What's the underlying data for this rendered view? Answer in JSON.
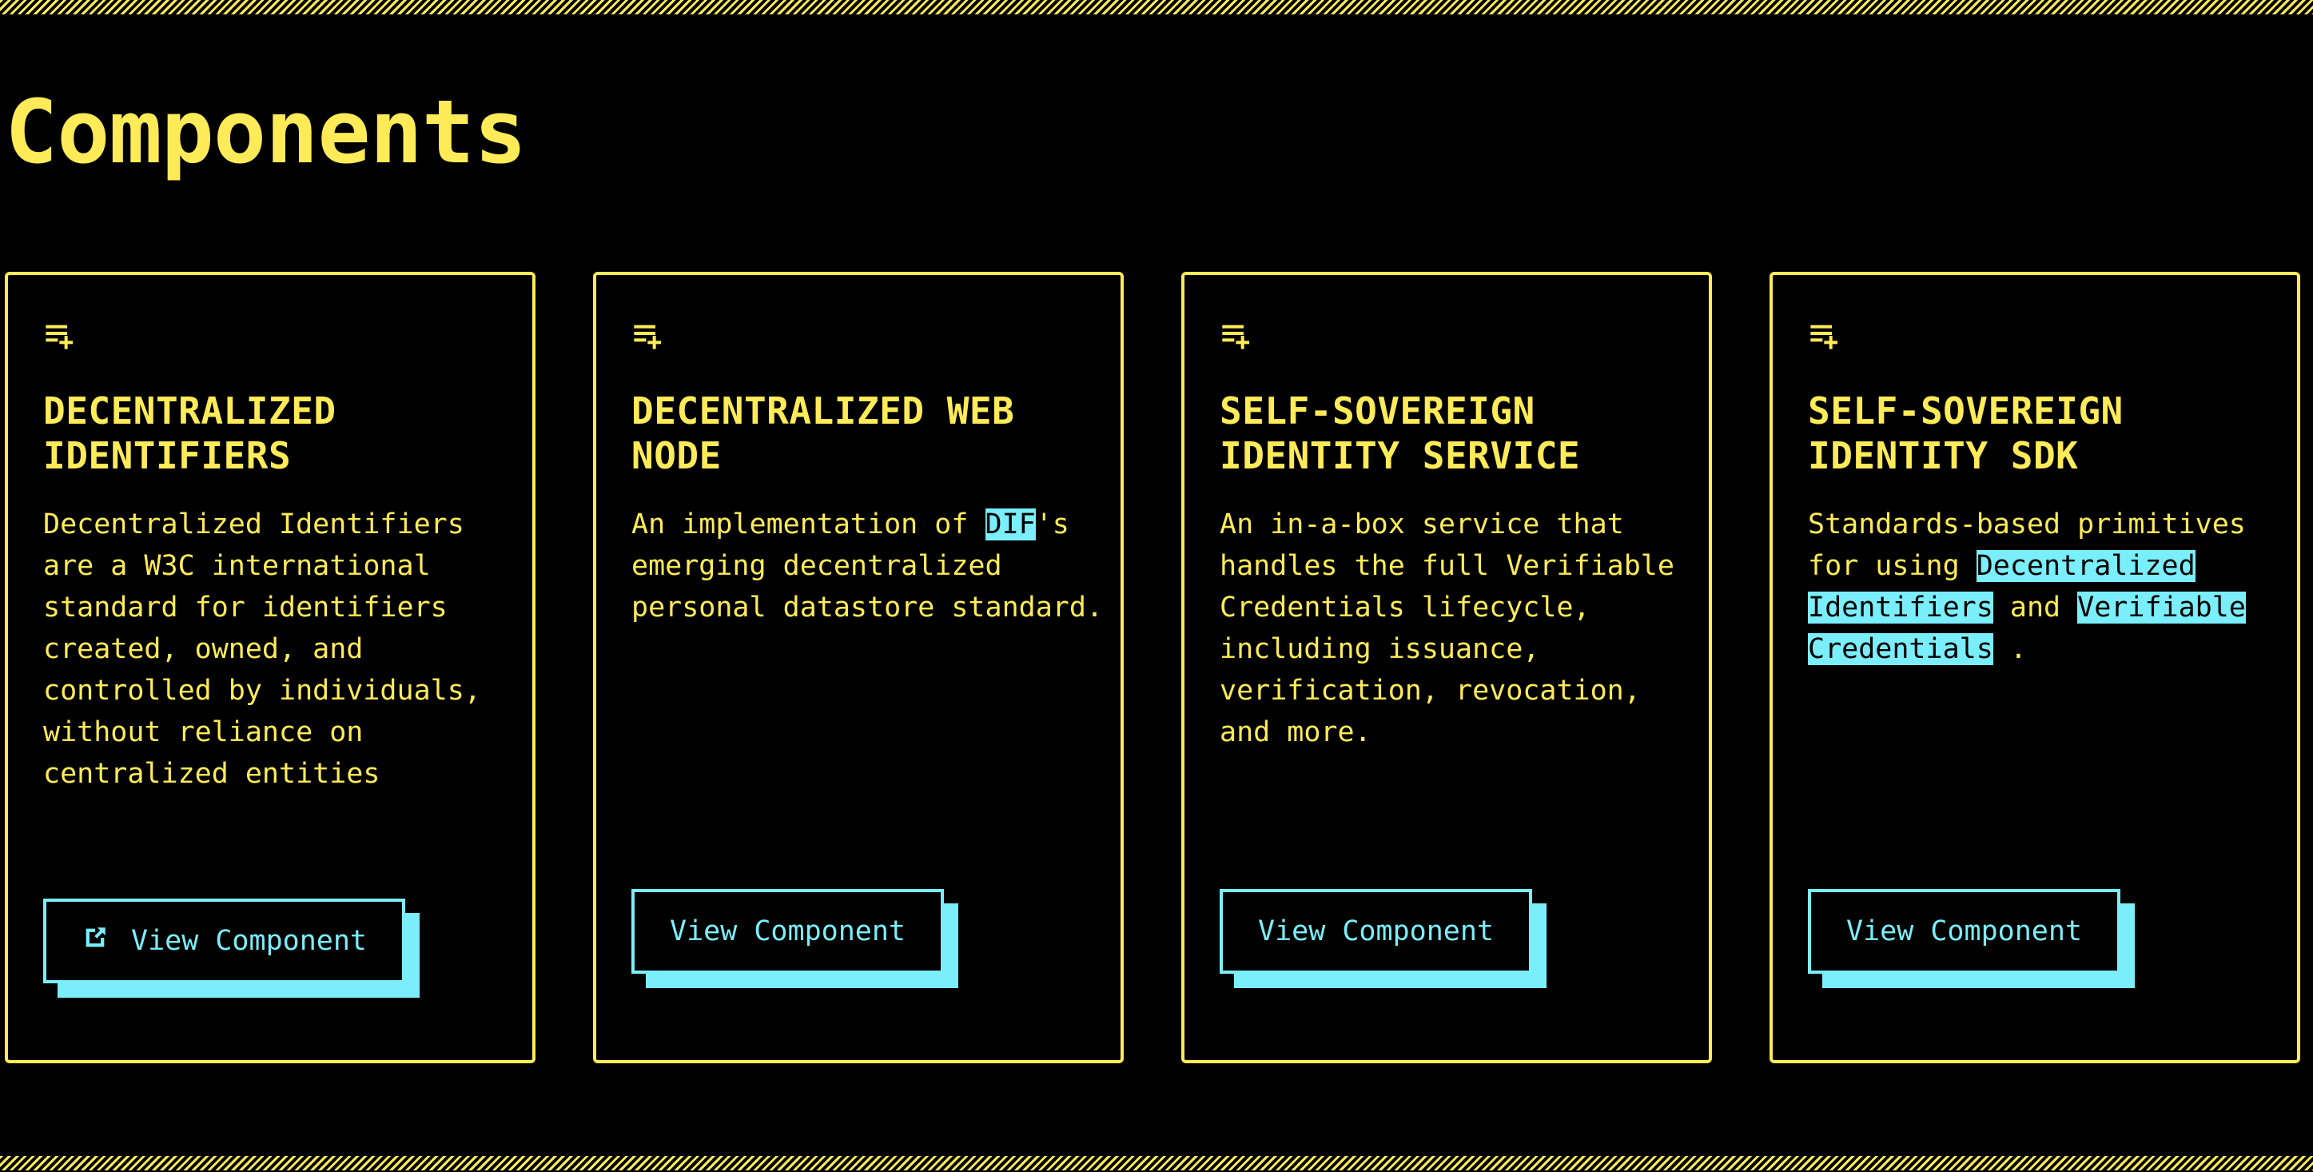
{
  "heading": "Components",
  "colors": {
    "accent": "#ffeb57",
    "button": "#7aeefa",
    "background": "#000000"
  },
  "cards": [
    {
      "icon": "playlist-add-icon",
      "title": "DECENTRALIZED IDENTIFIERS",
      "desc": [
        {
          "t": "Decentralized Identifiers are a W3C international standard for identifiers created, owned, and controlled by individuals, without reliance on centralized entities"
        }
      ],
      "button": "View Component",
      "button_icon": "external-link-icon"
    },
    {
      "icon": "playlist-add-icon",
      "title": "DECENTRALIZED WEB NODE",
      "desc": [
        {
          "t": "An implementation of "
        },
        {
          "t": "DIF",
          "hl": true
        },
        {
          "t": "'s emerging decentralized personal datastore standard."
        }
      ],
      "button": "View Component"
    },
    {
      "icon": "playlist-add-icon",
      "title": "SELF-SOVEREIGN IDENTITY SERVICE",
      "desc": [
        {
          "t": "An in-a-box service that handles the full Verifiable Credentials lifecycle, including issuance, verification, revocation, and more."
        }
      ],
      "button": "View Component"
    },
    {
      "icon": "playlist-add-icon",
      "title": "SELF-SOVEREIGN IDENTITY SDK",
      "desc": [
        {
          "t": "Standards-based primitives for using "
        },
        {
          "t": "Decentralized Identifiers",
          "hl": true
        },
        {
          "t": " and "
        },
        {
          "t": "Verifiable Credentials",
          "hl": true
        },
        {
          "t": " ."
        }
      ],
      "button": "View Component"
    }
  ]
}
